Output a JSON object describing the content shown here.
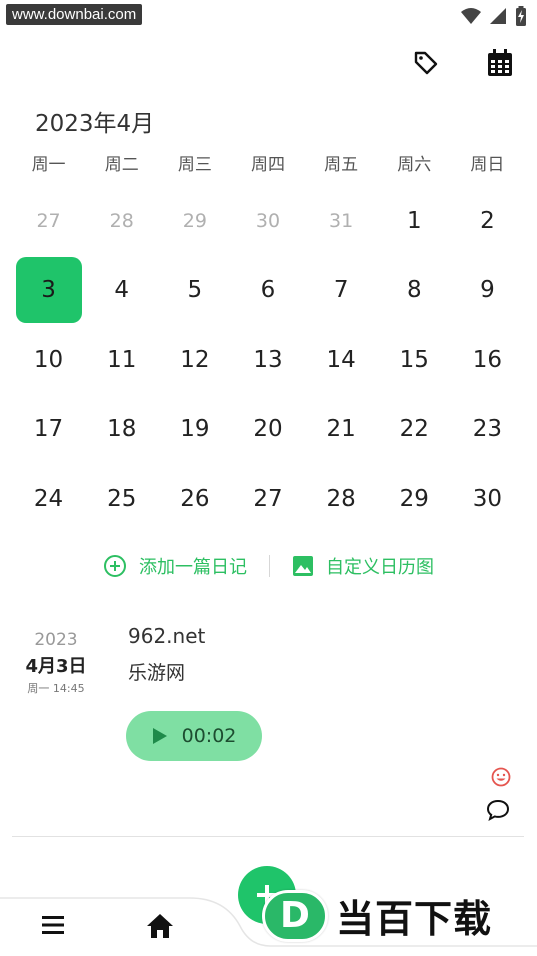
{
  "status": {
    "watermark": "www.downbai.com"
  },
  "toolbar": {
    "tag_icon": "tag-icon",
    "calendar_icon": "calendar-icon"
  },
  "calendar": {
    "month_title": "2023年4月",
    "weekdays": [
      "周一",
      "周二",
      "周三",
      "周四",
      "周五",
      "周六",
      "周日"
    ],
    "days": [
      {
        "n": "27",
        "muted": true
      },
      {
        "n": "28",
        "muted": true
      },
      {
        "n": "29",
        "muted": true
      },
      {
        "n": "30",
        "muted": true
      },
      {
        "n": "31",
        "muted": true
      },
      {
        "n": "1"
      },
      {
        "n": "2"
      },
      {
        "n": "3",
        "selected": true
      },
      {
        "n": "4"
      },
      {
        "n": "5"
      },
      {
        "n": "6"
      },
      {
        "n": "7"
      },
      {
        "n": "8"
      },
      {
        "n": "9"
      },
      {
        "n": "10"
      },
      {
        "n": "11"
      },
      {
        "n": "12"
      },
      {
        "n": "13"
      },
      {
        "n": "14"
      },
      {
        "n": "15"
      },
      {
        "n": "16"
      },
      {
        "n": "17"
      },
      {
        "n": "18"
      },
      {
        "n": "19"
      },
      {
        "n": "20"
      },
      {
        "n": "21"
      },
      {
        "n": "22"
      },
      {
        "n": "23"
      },
      {
        "n": "24"
      },
      {
        "n": "25"
      },
      {
        "n": "26"
      },
      {
        "n": "27"
      },
      {
        "n": "28"
      },
      {
        "n": "29"
      },
      {
        "n": "30"
      }
    ]
  },
  "actions": {
    "add_diary": "添加一篇日记",
    "custom_image": "自定义日历图"
  },
  "entry": {
    "year": "2023",
    "month_day": "4月3日",
    "weekday_time": "周一 14:45",
    "title": "962.net",
    "body": "乐游网",
    "audio_duration": "00:02"
  },
  "brand": {
    "logo_letter": "D",
    "name": "当百下载"
  },
  "colors": {
    "accent": "#1fc46a",
    "audio_bg": "#7fdfa3",
    "muted": "#b0b0b0"
  }
}
